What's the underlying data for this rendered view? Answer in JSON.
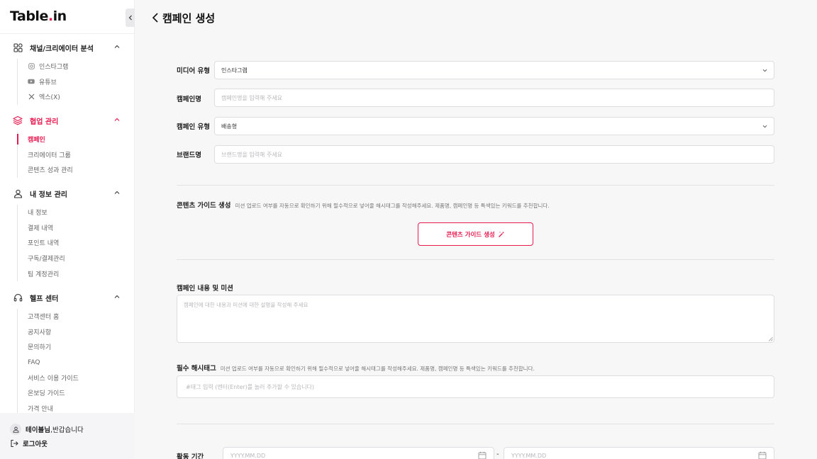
{
  "sidebar": {
    "logo_main": "Table",
    "logo_dot": ".",
    "logo_end": "in",
    "sections": [
      {
        "title": "채널/크리에이터 분석",
        "icon": "grid-icon",
        "items": [
          {
            "label": "인스타그램",
            "icon": "instagram-icon"
          },
          {
            "label": "유튜브",
            "icon": "youtube-icon"
          },
          {
            "label": "엑스(X)",
            "icon": "x-icon"
          }
        ]
      },
      {
        "title": "협업 관리",
        "icon": "layers-icon",
        "items": [
          {
            "label": "캠페인"
          },
          {
            "label": "크리에이터 그룹"
          },
          {
            "label": "콘텐츠 성과 관리"
          }
        ]
      },
      {
        "title": "내 정보 관리",
        "icon": "user-icon",
        "items": [
          {
            "label": "내 정보"
          },
          {
            "label": "결제 내역"
          },
          {
            "label": "포인트 내역"
          },
          {
            "label": "구독/결제관리"
          },
          {
            "label": "팀 계정관리"
          }
        ]
      },
      {
        "title": "헬프 센터",
        "icon": "headset-icon",
        "items": [
          {
            "label": "고객센터 홈"
          },
          {
            "label": "공지사항"
          },
          {
            "label": "문의하기"
          },
          {
            "label": "FAQ"
          },
          {
            "label": "서비스 이용 가이드"
          },
          {
            "label": "온보딩 가이드"
          },
          {
            "label": "가격 안내"
          }
        ]
      }
    ],
    "user_name": "테이블님",
    "user_greeting": ",반갑습니다",
    "logout": "로그아웃"
  },
  "header": {
    "title": "캠페인 생성"
  },
  "form": {
    "media_type": {
      "label": "미디어 유형",
      "value": "인스타그램"
    },
    "campaign_name": {
      "label": "캠페인명",
      "placeholder": "캠페인명을 입력해 주세요"
    },
    "campaign_type": {
      "label": "캠페인 유형",
      "value": "배송형"
    },
    "brand_name": {
      "label": "브랜드명",
      "placeholder": "브랜드명을 입력해 주세요"
    },
    "content_guide": {
      "label": "콘텐츠 가이드 생성",
      "help": "미션 업로드 여부를 자동으로 확인하기 위해 필수적으로 넣어줄 해시태그를 작성해주세요. 제품명, 캠페인명 등 특색있는 키워드를 추천합니다.",
      "button": "콘텐츠 가이드 생성"
    },
    "content_mission": {
      "label": "캠페인 내용 및 미션",
      "placeholder": "캠페인에 대한 내용과 미션에 대한 설명을 작성해 주세요"
    },
    "hashtags": {
      "label": "필수 해시태그",
      "help": "미션 업로드 여부를 자동으로 확인하기 위해 필수적으로 넣어줄 해시태그를 작성해주세요. 제품명, 캠페인명 등 특색있는 키워드를 추천합니다.",
      "placeholder": "#태그 입력 (엔터(Enter)를 눌러 추가할 수 있습니다)"
    },
    "period": {
      "label": "활동 기간",
      "start_placeholder": "YYYY.MM.DD",
      "separator": "-",
      "end_placeholder": "YYYY.MM.DD"
    }
  },
  "colors": {
    "accent": "#e8194f",
    "sidebar_bg": "#ffffff",
    "page_bg": "#f7f7f8"
  }
}
